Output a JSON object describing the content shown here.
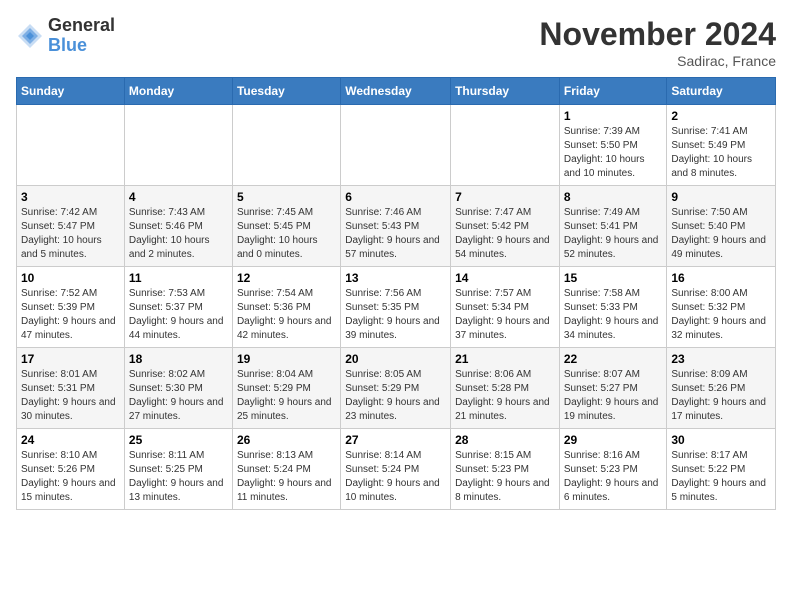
{
  "logo": {
    "general": "General",
    "blue": "Blue"
  },
  "title": "November 2024",
  "location": "Sadirac, France",
  "weekdays": [
    "Sunday",
    "Monday",
    "Tuesday",
    "Wednesday",
    "Thursday",
    "Friday",
    "Saturday"
  ],
  "weeks": [
    [
      {
        "day": "",
        "info": ""
      },
      {
        "day": "",
        "info": ""
      },
      {
        "day": "",
        "info": ""
      },
      {
        "day": "",
        "info": ""
      },
      {
        "day": "",
        "info": ""
      },
      {
        "day": "1",
        "info": "Sunrise: 7:39 AM\nSunset: 5:50 PM\nDaylight: 10 hours and 10 minutes."
      },
      {
        "day": "2",
        "info": "Sunrise: 7:41 AM\nSunset: 5:49 PM\nDaylight: 10 hours and 8 minutes."
      }
    ],
    [
      {
        "day": "3",
        "info": "Sunrise: 7:42 AM\nSunset: 5:47 PM\nDaylight: 10 hours and 5 minutes."
      },
      {
        "day": "4",
        "info": "Sunrise: 7:43 AM\nSunset: 5:46 PM\nDaylight: 10 hours and 2 minutes."
      },
      {
        "day": "5",
        "info": "Sunrise: 7:45 AM\nSunset: 5:45 PM\nDaylight: 10 hours and 0 minutes."
      },
      {
        "day": "6",
        "info": "Sunrise: 7:46 AM\nSunset: 5:43 PM\nDaylight: 9 hours and 57 minutes."
      },
      {
        "day": "7",
        "info": "Sunrise: 7:47 AM\nSunset: 5:42 PM\nDaylight: 9 hours and 54 minutes."
      },
      {
        "day": "8",
        "info": "Sunrise: 7:49 AM\nSunset: 5:41 PM\nDaylight: 9 hours and 52 minutes."
      },
      {
        "day": "9",
        "info": "Sunrise: 7:50 AM\nSunset: 5:40 PM\nDaylight: 9 hours and 49 minutes."
      }
    ],
    [
      {
        "day": "10",
        "info": "Sunrise: 7:52 AM\nSunset: 5:39 PM\nDaylight: 9 hours and 47 minutes."
      },
      {
        "day": "11",
        "info": "Sunrise: 7:53 AM\nSunset: 5:37 PM\nDaylight: 9 hours and 44 minutes."
      },
      {
        "day": "12",
        "info": "Sunrise: 7:54 AM\nSunset: 5:36 PM\nDaylight: 9 hours and 42 minutes."
      },
      {
        "day": "13",
        "info": "Sunrise: 7:56 AM\nSunset: 5:35 PM\nDaylight: 9 hours and 39 minutes."
      },
      {
        "day": "14",
        "info": "Sunrise: 7:57 AM\nSunset: 5:34 PM\nDaylight: 9 hours and 37 minutes."
      },
      {
        "day": "15",
        "info": "Sunrise: 7:58 AM\nSunset: 5:33 PM\nDaylight: 9 hours and 34 minutes."
      },
      {
        "day": "16",
        "info": "Sunrise: 8:00 AM\nSunset: 5:32 PM\nDaylight: 9 hours and 32 minutes."
      }
    ],
    [
      {
        "day": "17",
        "info": "Sunrise: 8:01 AM\nSunset: 5:31 PM\nDaylight: 9 hours and 30 minutes."
      },
      {
        "day": "18",
        "info": "Sunrise: 8:02 AM\nSunset: 5:30 PM\nDaylight: 9 hours and 27 minutes."
      },
      {
        "day": "19",
        "info": "Sunrise: 8:04 AM\nSunset: 5:29 PM\nDaylight: 9 hours and 25 minutes."
      },
      {
        "day": "20",
        "info": "Sunrise: 8:05 AM\nSunset: 5:29 PM\nDaylight: 9 hours and 23 minutes."
      },
      {
        "day": "21",
        "info": "Sunrise: 8:06 AM\nSunset: 5:28 PM\nDaylight: 9 hours and 21 minutes."
      },
      {
        "day": "22",
        "info": "Sunrise: 8:07 AM\nSunset: 5:27 PM\nDaylight: 9 hours and 19 minutes."
      },
      {
        "day": "23",
        "info": "Sunrise: 8:09 AM\nSunset: 5:26 PM\nDaylight: 9 hours and 17 minutes."
      }
    ],
    [
      {
        "day": "24",
        "info": "Sunrise: 8:10 AM\nSunset: 5:26 PM\nDaylight: 9 hours and 15 minutes."
      },
      {
        "day": "25",
        "info": "Sunrise: 8:11 AM\nSunset: 5:25 PM\nDaylight: 9 hours and 13 minutes."
      },
      {
        "day": "26",
        "info": "Sunrise: 8:13 AM\nSunset: 5:24 PM\nDaylight: 9 hours and 11 minutes."
      },
      {
        "day": "27",
        "info": "Sunrise: 8:14 AM\nSunset: 5:24 PM\nDaylight: 9 hours and 10 minutes."
      },
      {
        "day": "28",
        "info": "Sunrise: 8:15 AM\nSunset: 5:23 PM\nDaylight: 9 hours and 8 minutes."
      },
      {
        "day": "29",
        "info": "Sunrise: 8:16 AM\nSunset: 5:23 PM\nDaylight: 9 hours and 6 minutes."
      },
      {
        "day": "30",
        "info": "Sunrise: 8:17 AM\nSunset: 5:22 PM\nDaylight: 9 hours and 5 minutes."
      }
    ]
  ]
}
